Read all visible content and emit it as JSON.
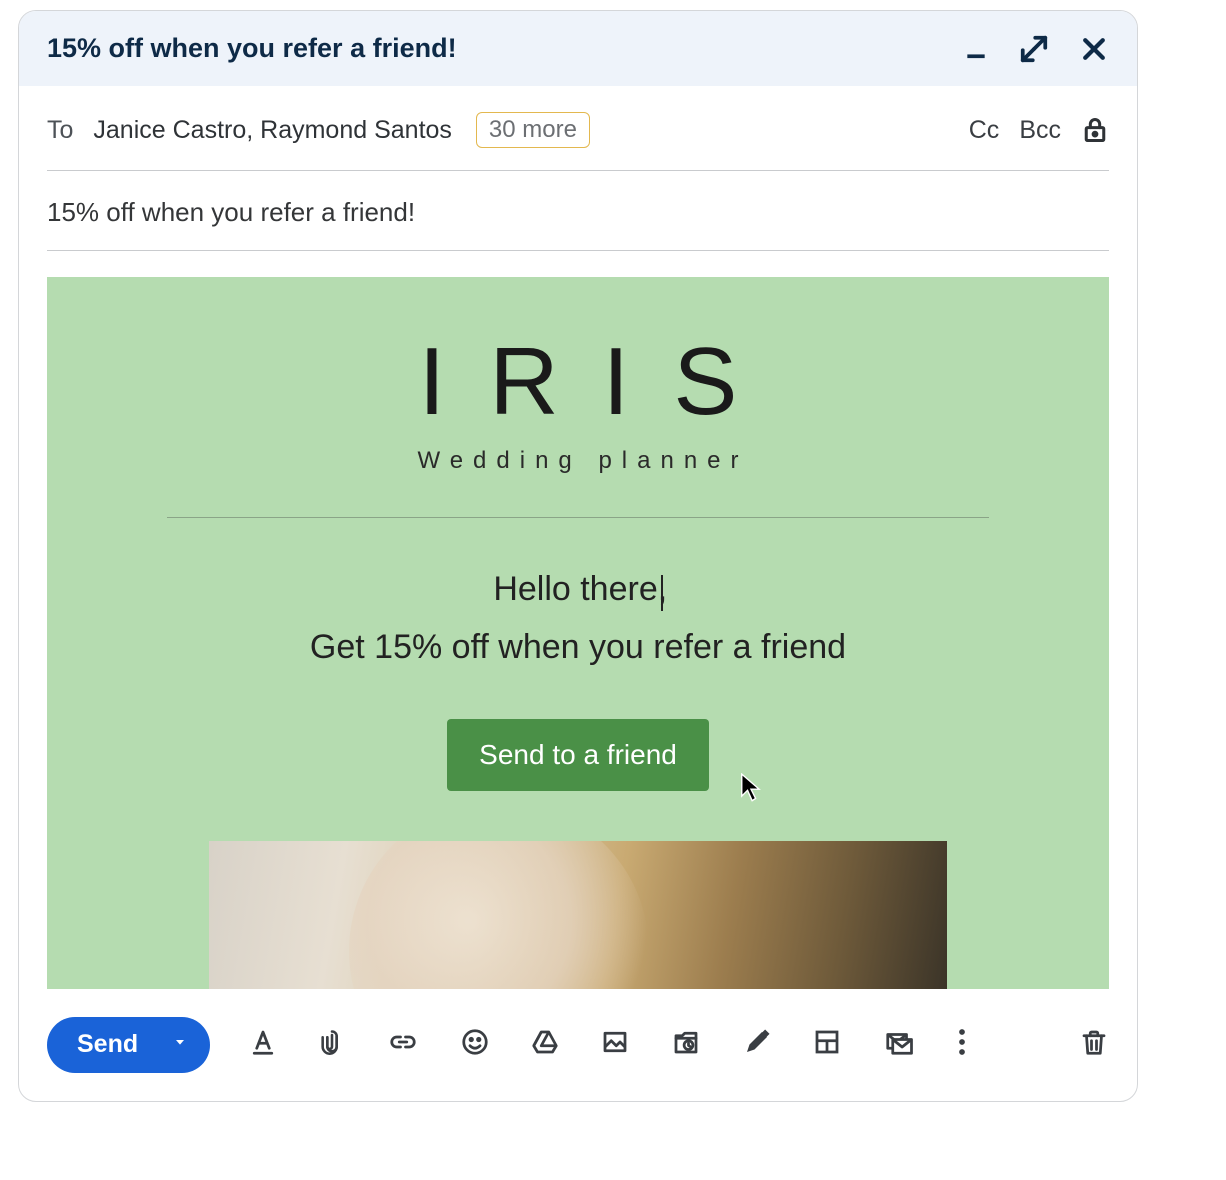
{
  "window": {
    "title": "15% off when you refer a friend!"
  },
  "to": {
    "label": "To",
    "recipients": "Janice Castro, Raymond Santos",
    "more_badge": "30 more",
    "cc_label": "Cc",
    "bcc_label": "Bcc"
  },
  "subject": {
    "text": "15% off when you refer a friend!"
  },
  "body": {
    "brand_name": "IRIS",
    "brand_sub": "Wedding planner",
    "hello": "Hello there,",
    "offer": "Get 15% off when you refer a friend",
    "cta": "Send to a friend"
  },
  "toolbar": {
    "send_label": "Send"
  }
}
